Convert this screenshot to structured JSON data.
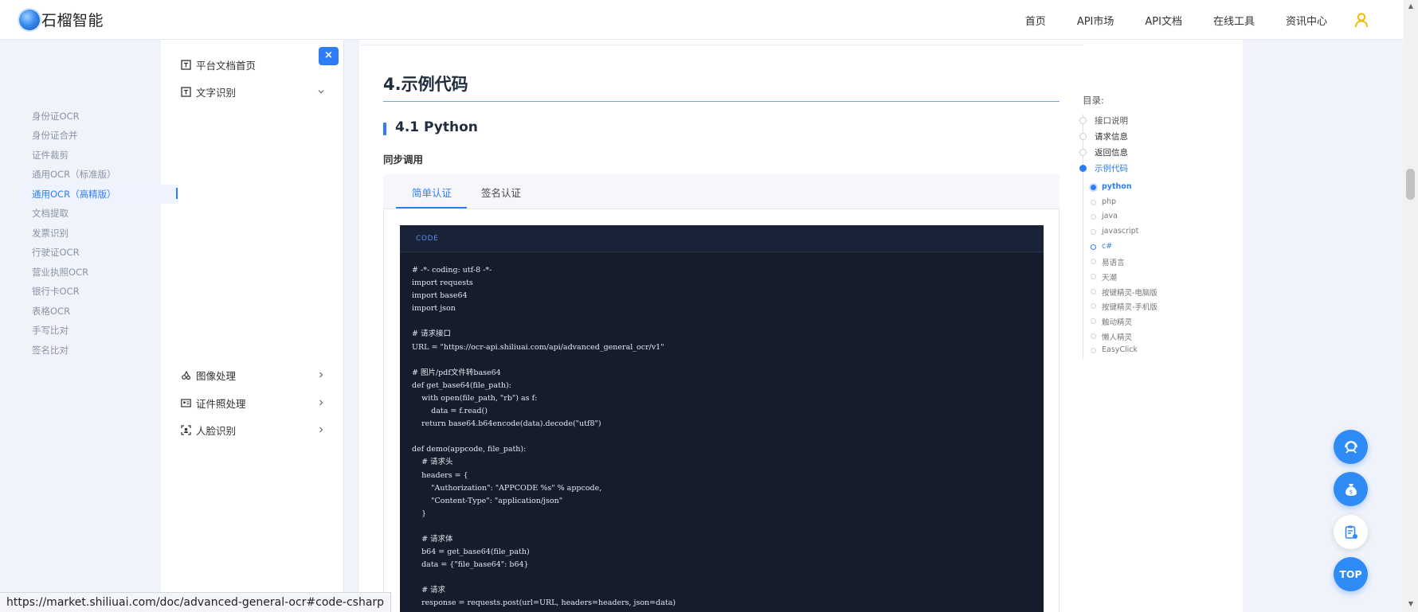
{
  "brand": {
    "name": "石榴智能"
  },
  "nav": {
    "items": [
      "首页",
      "API市场",
      "API文档",
      "在线工具",
      "资讯中心"
    ]
  },
  "sidebar": {
    "close_label": "×",
    "home": "平台文档首页",
    "groups": [
      {
        "label": "文字识别"
      },
      {
        "label": "图像处理"
      },
      {
        "label": "证件照处理"
      },
      {
        "label": "人脸识别"
      }
    ],
    "ocr_items": [
      "身份证OCR",
      "身份证合并",
      "证件裁剪",
      "通用OCR（标准版）",
      "通用OCR（高精版）",
      "文档提取",
      "发票识别",
      "行驶证OCR",
      "营业执照OCR",
      "银行卡OCR",
      "表格OCR",
      "手写比对",
      "签名比对"
    ]
  },
  "content": {
    "h2": "4.示例代码",
    "h3": "4.1 Python",
    "sync_label": "同步调用",
    "tabs": [
      "简单认证",
      "签名认证"
    ],
    "code_tag": "CODE",
    "code": "# -*- coding: utf-8 -*-\nimport requests\nimport base64\nimport json\n\n# 请求接口\nURL = \"https://ocr-api.shiliuai.com/api/advanced_general_ocr/v1\"\n\n# 图片/pdf文件转base64\ndef get_base64(file_path):\n    with open(file_path, \"rb\") as f:\n        data = f.read()\n    return base64.b64encode(data).decode(\"utf8\")\n\ndef demo(appcode, file_path):\n    # 请求头\n    headers = {\n        \"Authorization\": \"APPCODE %s\" % appcode,\n        \"Content-Type\": \"application/json\"\n    }\n\n    # 请求体\n    b64 = get_base64(file_path)\n    data = {\"file_base64\": b64}\n\n    # 请求\n    response = requests.post(url=URL, headers=headers, json=data)"
  },
  "toc": {
    "title": "目录:",
    "items": [
      "接口说明",
      "请求信息",
      "返回信息",
      "示例代码"
    ],
    "sub_items": [
      "python",
      "php",
      "java",
      "javascript",
      "c#",
      "易语言",
      "天潮",
      "按键精灵-电脑版",
      "按键精灵-手机版",
      "触动精灵",
      "懒人精灵",
      "EasyClick"
    ]
  },
  "floating": {
    "top_label": "TOP"
  },
  "statusbar": {
    "url": "https://market.shiliuai.com/doc/advanced-general-ocr#code-csharp"
  },
  "colors": {
    "accent": "#2f7df6",
    "code_bg": "#151c2b",
    "page_bg": "#f0f3fa"
  }
}
